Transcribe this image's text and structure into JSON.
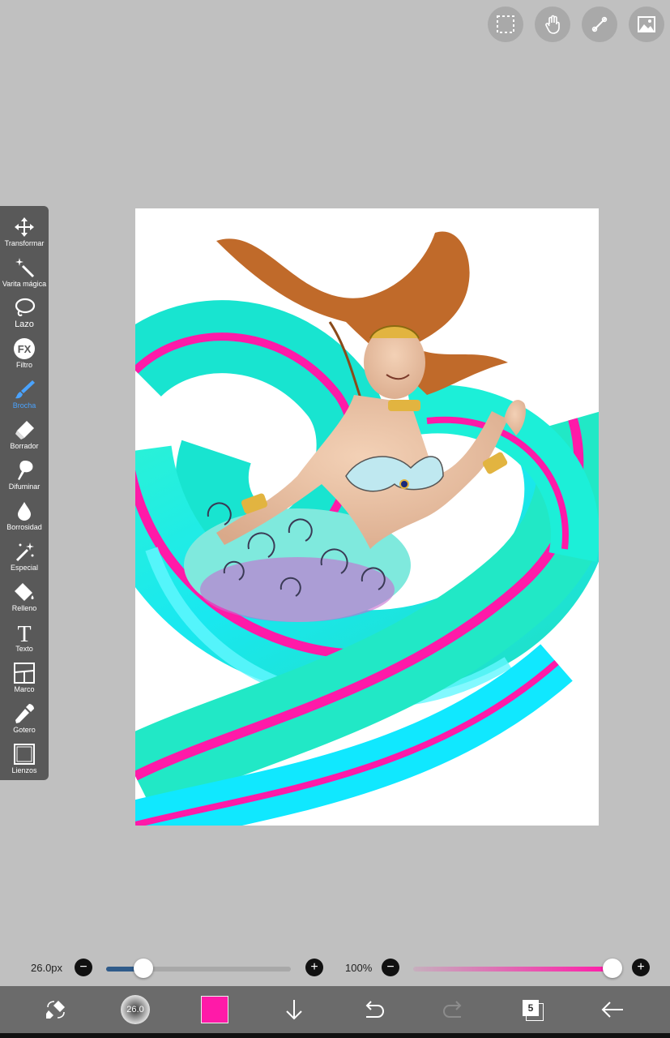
{
  "top_actions": [
    {
      "name": "selection-icon"
    },
    {
      "name": "hand-icon"
    },
    {
      "name": "ruler-icon"
    },
    {
      "name": "image-icon"
    }
  ],
  "toolbar": {
    "tools": [
      {
        "label": "Transformar",
        "icon": "move-icon"
      },
      {
        "label": "Varita mágica",
        "icon": "magic-wand-icon"
      },
      {
        "label": "Lazo",
        "icon": "lasso-icon"
      },
      {
        "label": "Filtro",
        "icon": "fx-icon"
      },
      {
        "label": "Brocha",
        "icon": "brush-icon",
        "active": true
      },
      {
        "label": "Borrador",
        "icon": "eraser-icon"
      },
      {
        "label": "Difuminar",
        "icon": "smudge-icon"
      },
      {
        "label": "Borrosidad",
        "icon": "blur-drop-icon"
      },
      {
        "label": "Especial",
        "icon": "special-wand-icon"
      },
      {
        "label": "Relleno",
        "icon": "fill-bucket-icon"
      },
      {
        "label": "Texto",
        "icon": "text-icon"
      },
      {
        "label": "Marco",
        "icon": "frame-icon"
      },
      {
        "label": "Gotero",
        "icon": "eyedropper-icon"
      },
      {
        "label": "Lienzos",
        "icon": "canvas-icon"
      }
    ],
    "fx_text": "FX",
    "text_glyph": "T"
  },
  "brush_size": {
    "label": "26.0px",
    "value_fraction": 0.2
  },
  "opacity": {
    "label": "100%",
    "value_fraction": 1.0
  },
  "bottom_bar": {
    "brush_preview_label": "26.0",
    "color": "#ff1aa8",
    "layers_count": "5"
  },
  "colors": {
    "accent": "#4aa3ff",
    "toolbar_bg": "#595959",
    "bottombar_bg": "#6b6b6b",
    "size_track": "#2f5b8a",
    "opacity_track": "#ff1aa8"
  }
}
